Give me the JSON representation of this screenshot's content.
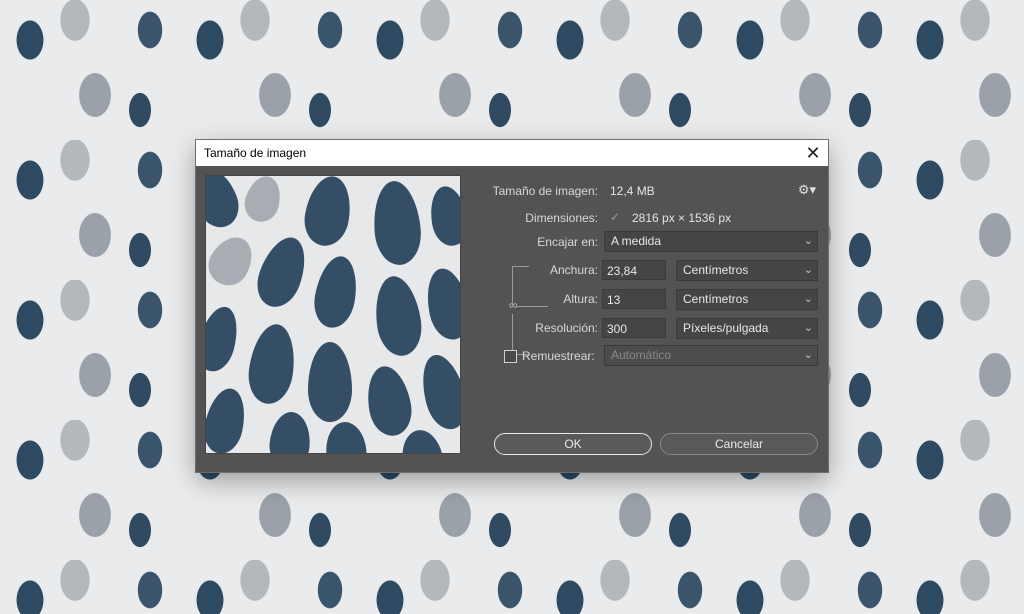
{
  "dialog": {
    "title": "Tamaño de imagen",
    "image_size_label": "Tamaño de imagen:",
    "image_size_value": "12,4 MB",
    "dimensions_label": "Dimensiones:",
    "dimensions_value": "2816 px × 1536 px",
    "fit_label": "Encajar en:",
    "fit_value": "A medida",
    "width_label": "Anchura:",
    "width_value": "23,84",
    "width_unit": "Centímetros",
    "height_label": "Altura:",
    "height_value": "13",
    "height_unit": "Centímetros",
    "resolution_label": "Resolución:",
    "resolution_value": "300",
    "resolution_unit": "Píxeles/pulgada",
    "resample_label": "Remuestrear:",
    "resample_value": "Automático",
    "ok_label": "OK",
    "cancel_label": "Cancelar"
  },
  "icons": {
    "close": "close-icon",
    "settings": "gear-icon",
    "dimensions_toggle": "checkmark-icon",
    "link": "chain-link-icon",
    "dropdown": "chevron-down-icon"
  },
  "colors": {
    "dialog_bg": "#535353",
    "field_bg": "#454545",
    "pattern_dark": "#344e66",
    "pattern_light": "#e9ebec"
  }
}
